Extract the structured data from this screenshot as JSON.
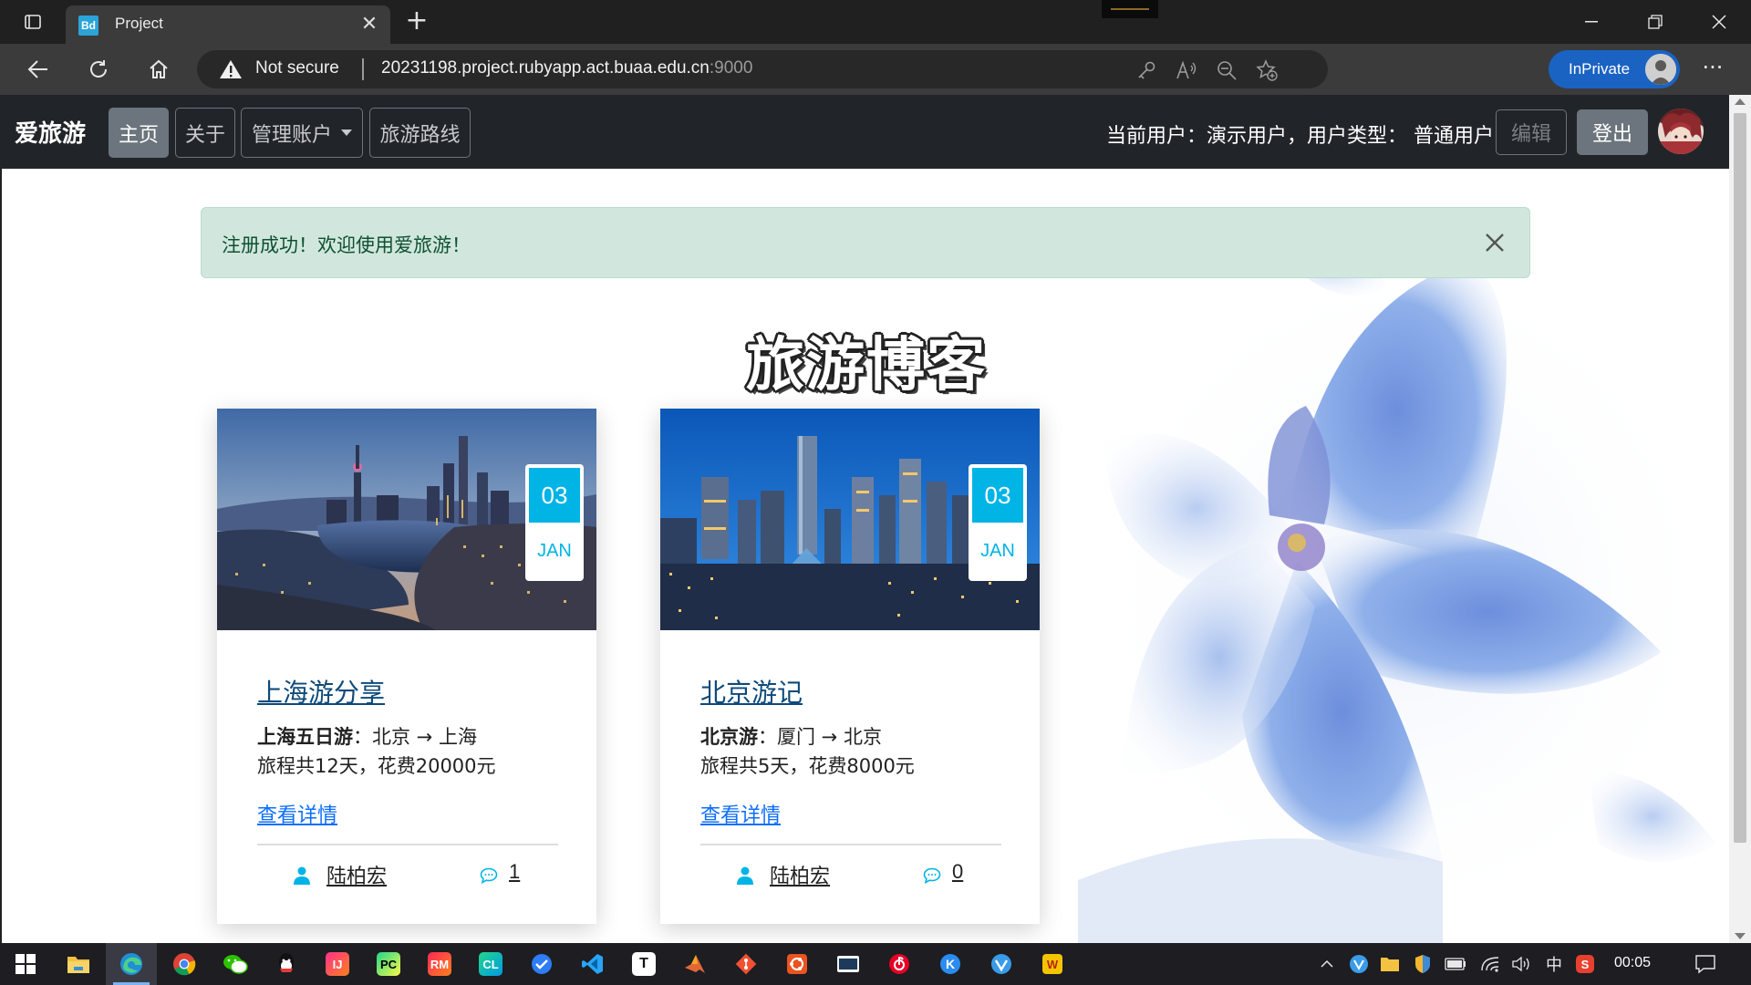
{
  "browser": {
    "tab_title": "Project",
    "tab_favicon_text": "Bd",
    "not_secure_label": "Not secure",
    "url_host": "20231198.project.rubyapp.act.buaa.edu.cn",
    "url_port": ":9000",
    "inprivate_label": "InPrivate"
  },
  "navbar": {
    "brand": "爱旅游",
    "items": [
      {
        "label": "主页",
        "active": true
      },
      {
        "label": "关于",
        "active": false
      },
      {
        "label": "管理账户",
        "active": false,
        "dropdown": true
      },
      {
        "label": "旅游路线",
        "active": false
      }
    ],
    "user_info": "当前用户：演示用户，用户类型：  普通用户",
    "edit_label": "编辑",
    "logout_label": "登出"
  },
  "alert": {
    "message": "注册成功！欢迎使用爱旅游！"
  },
  "blog": {
    "title": "旅游博客",
    "cards": [
      {
        "day": "03",
        "month": "JAN",
        "title": "上海游分享",
        "trip_name": "上海五日游",
        "route": "：北京 → 上海",
        "summary": "旅程共12天，花费20000元",
        "link": "查看详情",
        "author": "陆柏宏",
        "comments": "1"
      },
      {
        "day": "03",
        "month": "JAN",
        "title": "北京游记",
        "trip_name": "北京游",
        "route": "：厦门 → 北京",
        "summary": "旅程共5天，花费8000元",
        "link": "查看详情",
        "author": "陆柏宏",
        "comments": "0"
      }
    ]
  },
  "taskbar": {
    "time": "00:05",
    "ime": "中"
  },
  "colors": {
    "accent": "#00b4e6",
    "navbar_bg": "#212529",
    "alert_bg": "#d1e7dd",
    "link": "#0d6efd"
  }
}
